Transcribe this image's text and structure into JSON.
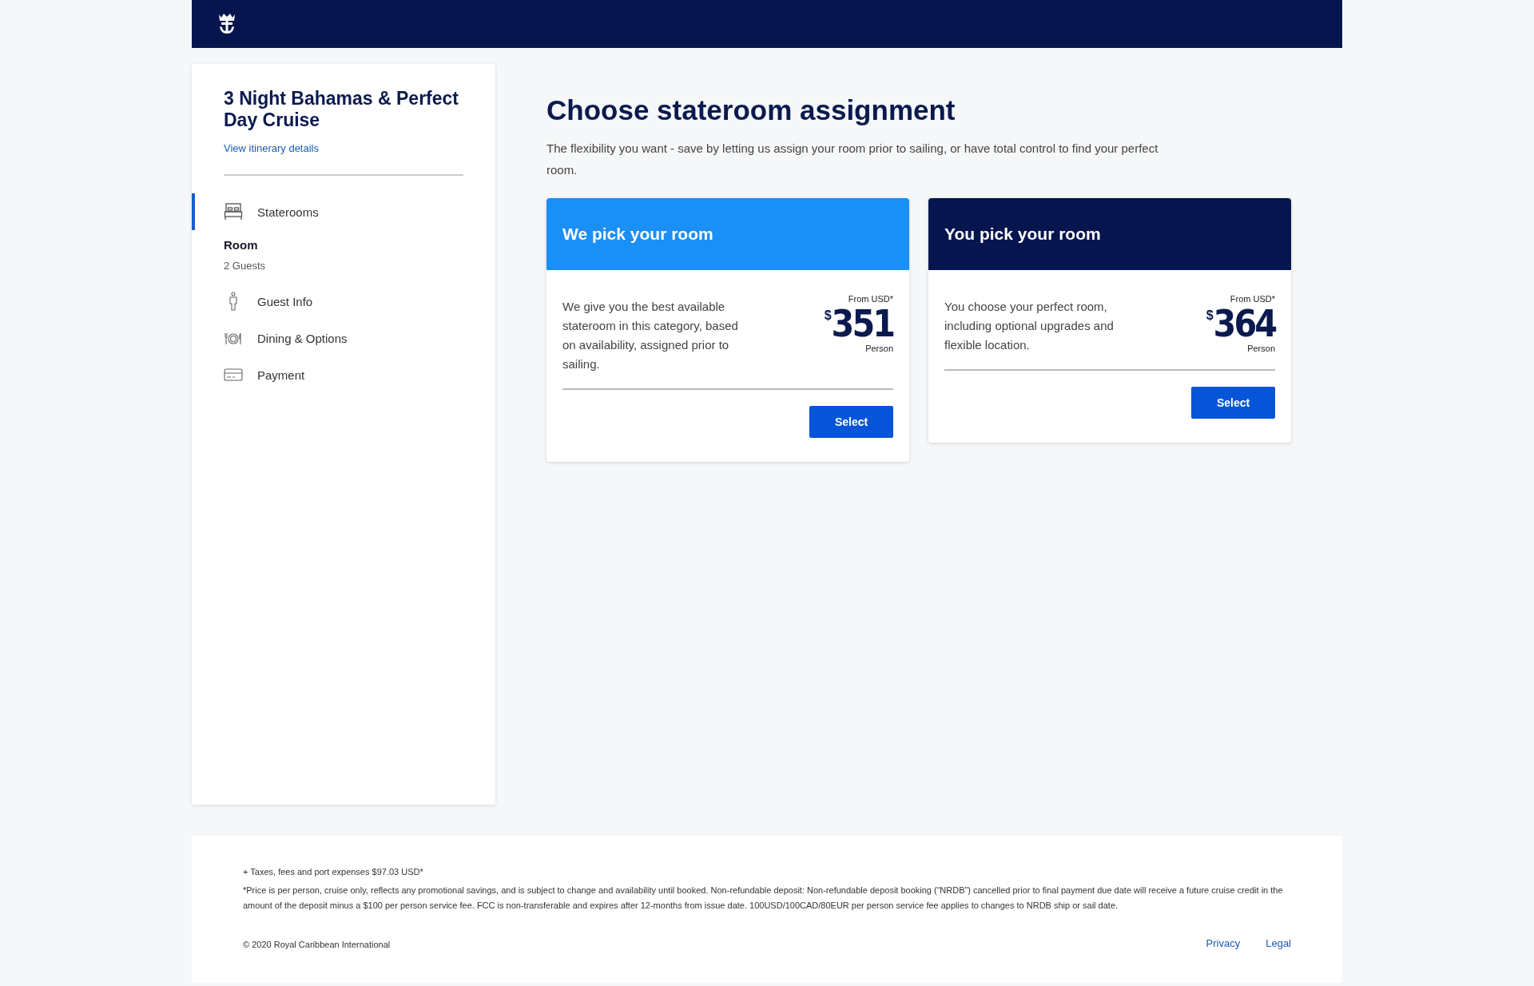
{
  "sidebar": {
    "title": "3 Night Bahamas & Perfect Day Cruise",
    "link": "View itinerary details",
    "steps": [
      {
        "kind": "bed",
        "label": "Staterooms",
        "selected": true,
        "sub": [
          {
            "kind": "title",
            "text": "Room"
          },
          {
            "kind": "detail",
            "text": "2 Guests"
          }
        ]
      },
      {
        "kind": "person",
        "label": "Guest Info",
        "selected": false
      },
      {
        "kind": "dining",
        "label": "Dining & Options",
        "selected": false
      },
      {
        "kind": "card",
        "label": "Payment",
        "selected": false
      }
    ]
  },
  "main": {
    "title": "Choose stateroom assignment",
    "subtitle": "The flexibility you want - save by letting us assign your room prior to sailing, or have total control to find your perfect room.",
    "options": [
      {
        "kind": "light",
        "title": "We pick your room",
        "description": "We give you the best available stateroom in this category, based on availability, assigned prior to sailing.",
        "from": "From USD*",
        "currency": "$",
        "price": "351",
        "per": "Person",
        "button": "Select"
      },
      {
        "kind": "dark",
        "title": "You pick your room",
        "description": "You choose your perfect room, including optional upgrades and flexible location.",
        "from": "From USD*",
        "currency": "$",
        "price": "364",
        "per": "Person",
        "button": "Select"
      }
    ]
  },
  "footer": {
    "notes": [
      "+ Taxes, fees and port expenses $97.03 USD*",
      "*Price is per person, cruise only, reflects any promotional savings, and is subject to change and availability until booked. Non-refundable deposit: Non-refundable deposit booking (“NRDB”) cancelled prior to final payment due date will receive a future cruise credit in the amount of the deposit minus a $100 per person service fee. FCC is non-transferable and expires after 12-months from issue date. 100USD/100CAD/80EUR per person service fee applies to changes to NRDB ship or sail date."
    ],
    "copyright": "© 2020 Royal Caribbean International",
    "links": [
      "Privacy",
      "Legal"
    ]
  }
}
